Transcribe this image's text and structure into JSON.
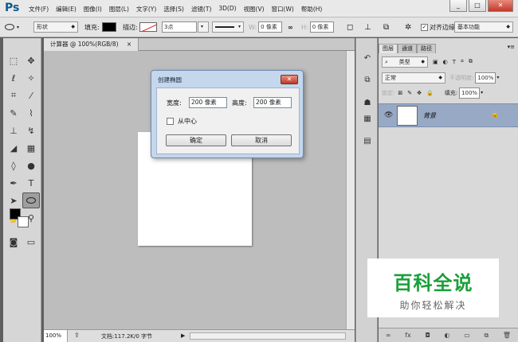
{
  "app": {
    "logo": "Ps"
  },
  "menu": [
    "文件(F)",
    "编辑(E)",
    "图像(I)",
    "图层(L)",
    "文字(Y)",
    "选择(S)",
    "滤镜(T)",
    "3D(D)",
    "视图(V)",
    "窗口(W)",
    "帮助(H)"
  ],
  "window_controls": {
    "minimize": "_",
    "maximize": "□",
    "close": "✕"
  },
  "options": {
    "mode": "形状",
    "fill_label": "填充:",
    "stroke_label": "描边:",
    "stroke_width": "3点",
    "w_label": "W:",
    "w_value": "0 像素",
    "link": "∞",
    "h_label": "H:",
    "h_value": "0 像素",
    "align_edges": "对齐边缘",
    "workspace": "基本功能"
  },
  "document": {
    "tab_title": "计算器 @ 100%(RGB/8)",
    "tab_close": "×",
    "zoom": "100%",
    "doc_info": "文档:117.2K/0 字节"
  },
  "dialog": {
    "title": "创建椭圆",
    "width_label": "宽度:",
    "width_value": "200 像素",
    "height_label": "高度:",
    "height_value": "200 像素",
    "from_center_label": "从中心",
    "from_center_checked": false,
    "ok": "确定",
    "cancel": "取消",
    "close": "✕"
  },
  "layers_panel": {
    "tabs": [
      "图层",
      "通道",
      "路径"
    ],
    "filter_kind": "类型",
    "blend_mode": "正常",
    "opacity_label": "不透明度:",
    "opacity_value": "100%",
    "lock_label": "锁定:",
    "fill_label": "填充:",
    "fill_value": "100%",
    "layer_name": "背景",
    "bottom_icons": [
      "∞",
      "fx",
      "◘",
      "◐",
      "▭",
      "⧉",
      "🗑"
    ]
  },
  "watermark": {
    "title": "百科全说",
    "subtitle": "助你轻松解决"
  },
  "colors": {
    "accent": "#0c5b8e",
    "layer_selected": "#97a9c5",
    "dialog_frame": "#c5d7ec",
    "watermark_green": "#1a9f3a"
  }
}
